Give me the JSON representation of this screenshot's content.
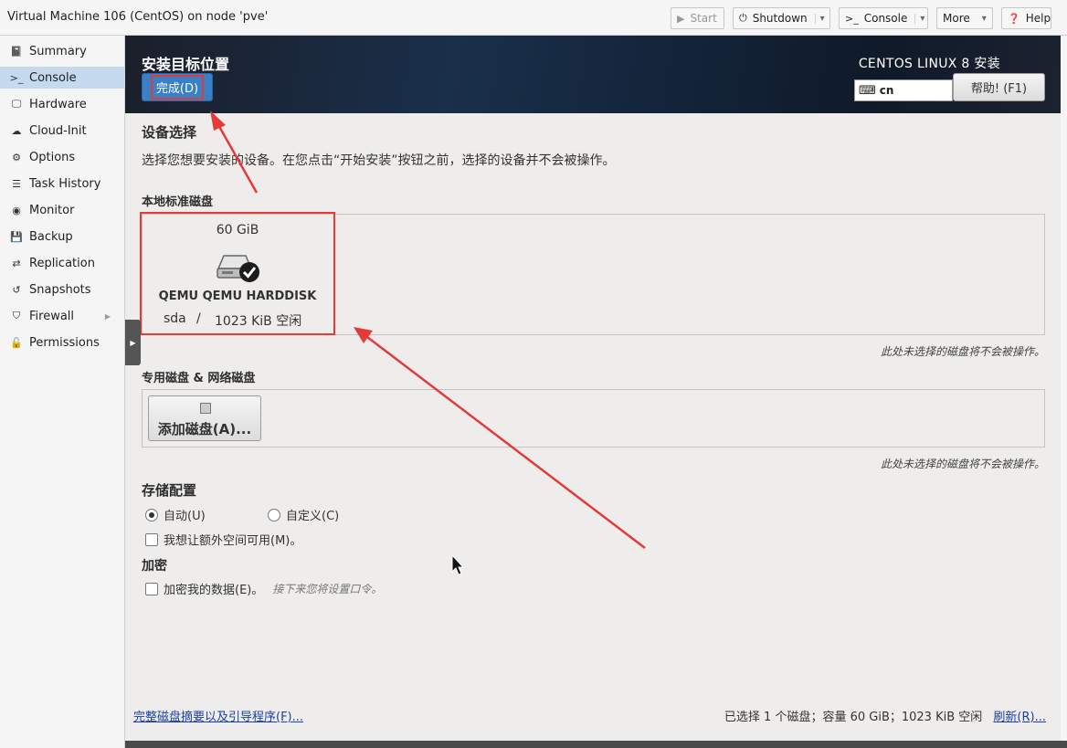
{
  "window": {
    "title": "Virtual Machine 106 (CentOS) on node 'pve'"
  },
  "toolbar": {
    "start_label": "Start",
    "shutdown_label": "Shutdown",
    "console_label": "Console",
    "more_label": "More",
    "help_label": "Help"
  },
  "sidebar": {
    "items": [
      {
        "label": "Summary",
        "icon": "book-icon"
      },
      {
        "label": "Console",
        "icon": "terminal-icon",
        "active": true
      },
      {
        "label": "Hardware",
        "icon": "monitor-icon"
      },
      {
        "label": "Cloud-Init",
        "icon": "cloud-icon"
      },
      {
        "label": "Options",
        "icon": "gear-icon"
      },
      {
        "label": "Task History",
        "icon": "list-icon"
      },
      {
        "label": "Monitor",
        "icon": "eye-icon"
      },
      {
        "label": "Backup",
        "icon": "floppy-icon"
      },
      {
        "label": "Replication",
        "icon": "retweet-icon"
      },
      {
        "label": "Snapshots",
        "icon": "history-icon"
      },
      {
        "label": "Firewall",
        "icon": "shield-icon"
      },
      {
        "label": "Permissions",
        "icon": "unlock-icon"
      }
    ]
  },
  "installer": {
    "title": "安装目标位置",
    "done_button": "完成(D)",
    "product": "CENTOS LINUX 8 安装",
    "keyboard_layout": "cn",
    "help_button": "帮助!  (F1)",
    "device_selection_title": "设备选择",
    "device_selection_desc": "选择您想要安装的设备。在您点击“开始安装”按钮之前，选择的设备并不会被操作。",
    "local_disks_label": "本地标准磁盘",
    "disk": {
      "size": "60 GiB",
      "name": "QEMU QEMU HARDDISK",
      "device": "sda",
      "separator": "/",
      "free": "1023 KiB 空闲"
    },
    "unselected_note": "此处未选择的磁盘将不会被操作。",
    "special_disks_label": "专用磁盘 & 网络磁盘",
    "add_disk_button": "添加磁盘(A)...",
    "unselected_note_2": "此处未选择的磁盘将不会被操作。",
    "storage_config_title": "存储配置",
    "auto_option": "自动(U)",
    "custom_option": "自定义(C)",
    "extra_space_option": "我想让额外空间可用(M)。",
    "encryption_title": "加密",
    "encrypt_option": "加密我的数据(E)。",
    "encrypt_hint": "接下来您将设置口令。",
    "summary_link": "完整磁盘摘要以及引导程序(F)...",
    "status_text": "已选择 1 个磁盘；容量 60 GiB；1023 KiB 空闲",
    "refresh_link": "刷新(R)..."
  },
  "colors": {
    "accent_blue": "#3a80c6",
    "annotation_red": "#e53a3a",
    "sidebar_active": "#c5daee",
    "link_blue": "#1a3fa8"
  }
}
